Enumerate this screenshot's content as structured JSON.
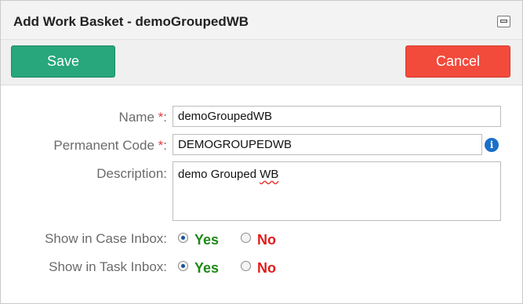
{
  "dialog": {
    "title": "Add Work Basket - demoGroupedWB",
    "restore_icon": "window-restore-icon"
  },
  "toolbar": {
    "save_label": "Save",
    "cancel_label": "Cancel"
  },
  "form": {
    "name_label": "Name",
    "name_value": "demoGroupedWB",
    "code_label": "Permanent Code",
    "code_value": "DEMOGROUPEDWB",
    "required_marker": "*",
    "colon": ":",
    "info_icon": "info-icon",
    "description_label": "Description:",
    "description_value_prefix": "demo Grouped ",
    "description_value_misspelled": "WB",
    "case_inbox_label": "Show in Case Inbox:",
    "task_inbox_label": "Show in Task Inbox:",
    "yes_label": "Yes",
    "no_label": "No",
    "case_inbox_selected": "Yes",
    "task_inbox_selected": "Yes"
  },
  "colors": {
    "save_button": "#27a77b",
    "cancel_button": "#f24a3b",
    "yes_text": "#1f8a18",
    "no_text": "#e11b1b",
    "required": "#e53935",
    "info": "#1a6fc9"
  }
}
